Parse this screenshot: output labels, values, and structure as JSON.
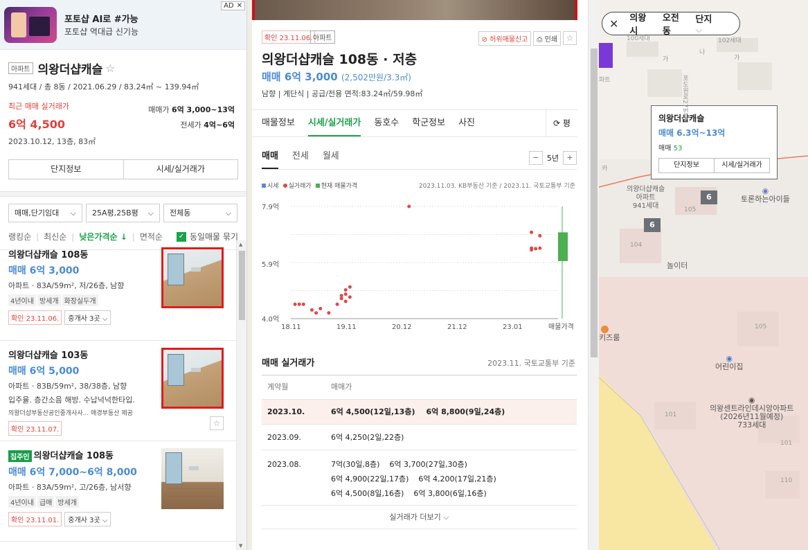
{
  "ad": {
    "title": "포토샵 AI로 #가능",
    "subtitle": "포토샵 역대급 신기능",
    "badge": "AD",
    "close": "✕"
  },
  "complex": {
    "tag": "아파트",
    "name": "의왕더샵캐슬",
    "info": "941세대 / 총 8동 / 2021.06.29 / 83.24㎡ ~ 139.94㎡",
    "recent_label": "최근 매매 실거래가",
    "recent_price": "6억 4,500",
    "recent_date": "2023.10.12, 13층, 83㎡",
    "sale_label": "매매가",
    "sale_range": "6억 3,000~13억",
    "jeonse_label": "전세가",
    "jeonse_range": "4억~6억",
    "btn_info": "단지정보",
    "btn_price": "시세/실거래가"
  },
  "filters": {
    "type": "매매,단기임대",
    "area": "25A평,25B평",
    "dong": "전체동"
  },
  "sorts": {
    "ranking": "랭킹순",
    "latest": "최신순",
    "low_price": "낮은가격순 ↓",
    "area": "면적순",
    "group": "동일매물 묶기"
  },
  "listings": [
    {
      "name": "의왕더샵캐슬 108동",
      "price": "매매 6억 3,000",
      "desc": "아파트 · 83A/59m², 저/26층, 남향",
      "chips": [
        "4년이내",
        "방세개",
        "화장실두개"
      ],
      "confirm": "확인 23.11.06.",
      "agents": "중개사 3곳"
    },
    {
      "name": "의왕더샵캐슬 103동",
      "price": "매매 6억 5,000",
      "desc": "아파트 · 83B/59m², 38/38층, 남향",
      "desc2": "입주율. 층간소음 해방. 수납넉넉한타입.",
      "sub": "의왕더샵부동산공인중개사사...   매경부동산 제공",
      "confirm": "확인 23.11.07."
    },
    {
      "badge": "집주인",
      "name": "의왕더샵캐슬 108동",
      "price": "매매 6억 7,000~6억 8,000",
      "desc": "아파트 · 83A/59m², 고/26층, 남서향",
      "chips": [
        "4년이내",
        "급매",
        "방세개"
      ],
      "confirm": "확인 23.11.01.",
      "agents": "중개사 3곳"
    }
  ],
  "detail": {
    "confirm": "확인 23.11.06.",
    "tag": "아파트",
    "report": "⊘ 허위매물신고",
    "print": "⎙ 인쇄",
    "title": "의왕더샵캐슬 108동 · 저층",
    "price": "매매 6억 3,000",
    "price_per": "(2,502만원/3.3㎡)",
    "info": "남향  |  계단식  |  공급/전용 면적:83.24㎡/59.98㎡",
    "tabs": [
      "매물정보",
      "시세/실거래가",
      "동호수",
      "학군정보",
      "사진"
    ],
    "refresh": "⟳ 평",
    "sub_tabs": [
      "매매",
      "전세",
      "월세"
    ],
    "years": "5년",
    "legend": {
      "market": "시세",
      "actual": "실거래가",
      "current": "현재 매물가격"
    },
    "source": "2023.11.03. KB부동산 기준 / 2023.11. 국토교통부 기준",
    "table_title": "매매 실거래가",
    "table_source": "2023.11. 국토교통부 기준",
    "table_headers": [
      "계약월",
      "매매가"
    ],
    "rows": [
      {
        "month": "2023.10.",
        "deals": [
          "6억 4,500(12일,13층)",
          "6억 8,800(9일,24층)"
        ]
      },
      {
        "month": "2023.09.",
        "deals": [
          "6억 4,250(2일,22층)"
        ]
      },
      {
        "month": "2023.08.",
        "deals": [
          "7억(30일,8층)",
          "6억 3,700(27일,30층)",
          "6억 4,900(22일,17층)",
          "6억 4,200(17일,21층)",
          "6억 4,500(8일,16층)",
          "6억 3,800(6일,16층)"
        ]
      }
    ],
    "more": "실거래가 더보기 ⌵"
  },
  "chart_data": {
    "type": "scatter",
    "xlabel": "",
    "ylabel": "",
    "x_ticks": [
      "18.11",
      "19.11",
      "20.12",
      "21.12",
      "23.01",
      "매물가격"
    ],
    "y_ticks": [
      "7.9억",
      "5.9억",
      "4.0억"
    ],
    "ylim": [
      4.0,
      7.9
    ],
    "series": [
      {
        "name": "실거래가",
        "color": "#e04848",
        "points": [
          {
            "x": "2018.12",
            "y": 4.5
          },
          {
            "x": "2019.01",
            "y": 4.5
          },
          {
            "x": "2019.02",
            "y": 4.5
          },
          {
            "x": "2019.04",
            "y": 4.3
          },
          {
            "x": "2019.05",
            "y": 4.2
          },
          {
            "x": "2019.06",
            "y": 4.35
          },
          {
            "x": "2019.08",
            "y": 4.2
          },
          {
            "x": "2019.10",
            "y": 4.5
          },
          {
            "x": "2019.11",
            "y": 4.7
          },
          {
            "x": "2019.11",
            "y": 4.8
          },
          {
            "x": "2019.12",
            "y": 4.6
          },
          {
            "x": "2019.12",
            "y": 4.85
          },
          {
            "x": "2019.12",
            "y": 5.0
          },
          {
            "x": "2020.01",
            "y": 5.1
          },
          {
            "x": "2020.01",
            "y": 4.75
          },
          {
            "x": "2021.03",
            "y": 7.9
          },
          {
            "x": "2023.08",
            "y": 6.45
          },
          {
            "x": "2023.08",
            "y": 7.0
          },
          {
            "x": "2023.08",
            "y": 6.39
          },
          {
            "x": "2023.09",
            "y": 6.43
          },
          {
            "x": "2023.10",
            "y": 6.45
          },
          {
            "x": "2023.10",
            "y": 6.88
          }
        ]
      },
      {
        "name": "현재 매물가격",
        "color": "#4caf50",
        "range": [
          6.3,
          13.0
        ]
      }
    ]
  },
  "map": {
    "locality": "의왕시",
    "dong": "오전동",
    "complex": "단지",
    "popup": {
      "name": "의왕더샵캐슬",
      "price": "매매 6.3억~13억",
      "count_label": "매매",
      "count": "53",
      "btn_info": "단지정보",
      "btn_price": "시세/실거래가"
    },
    "markers": [
      "6",
      "6"
    ],
    "labels": {
      "complex": "의왕더샵캐슬\n아파트\n941세대",
      "school": "토론하는아이들",
      "play": "놀이터",
      "daycare": "어린이집",
      "apt2": "의왕센트라인데시앙아파트\n(2026년11월예정)\n733세대",
      "kids": "키즈룸",
      "b100": "100세대",
      "b102": "102세대",
      "parts": "파트",
      "na": "나",
      "ga1": "가",
      "ga2": "가",
      "road": "포도원로27번길",
      "n104": "104",
      "n105a": "105",
      "n105b": "105",
      "n101a": "101",
      "n101b": "101",
      "n110": "110",
      "ka": "카"
    }
  }
}
